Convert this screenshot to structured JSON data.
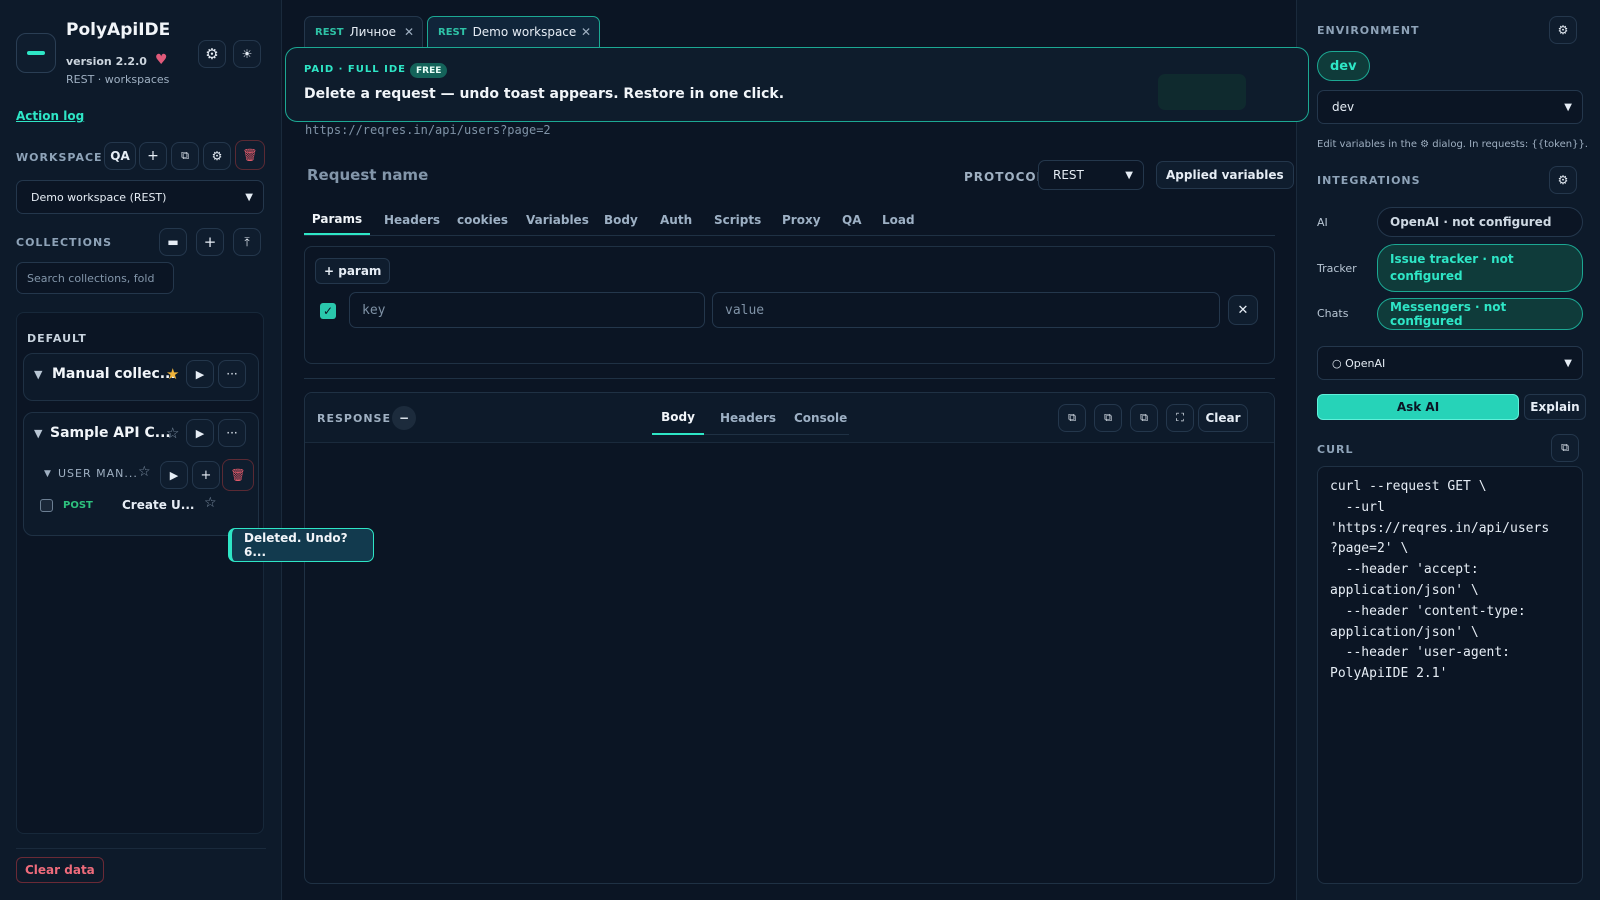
{
  "app": {
    "name": "PolyApiIDE",
    "version": "version 2.2.0",
    "subtitle": "REST · workspaces",
    "action_log": "Action log",
    "clear_data": "Clear data"
  },
  "workspace": {
    "label": "WORKSPACE",
    "badge": "QA",
    "selected": "Demo workspace (REST)"
  },
  "collections": {
    "label": "COLLECTIONS",
    "search_placeholder": "Search collections, fold",
    "group": "DEFAULT",
    "items": [
      {
        "name": "Manual collec...",
        "starred": true
      },
      {
        "name": "Sample API C...",
        "starred": false
      }
    ],
    "folder": {
      "name": "USER MAN..."
    },
    "request": {
      "method": "POST",
      "name": "Create U..."
    }
  },
  "undo_toast": "Deleted. Undo? 6...",
  "tabs": [
    {
      "proto": "REST",
      "label": "Личное"
    },
    {
      "proto": "REST",
      "label": "Demo workspace"
    }
  ],
  "banner": {
    "tier": "PAID · FULL IDE",
    "badge": "FREE",
    "message": "Delete a request — undo toast appears. Restore in one click."
  },
  "request": {
    "url": "https://reqres.in/api/users?page=2",
    "name_placeholder": "Request name",
    "protocol_label": "PROTOCOL",
    "protocol": "REST",
    "applied_vars": "Applied variables",
    "tabs": [
      "Params",
      "Headers",
      "cookies",
      "Variables",
      "Body",
      "Auth",
      "Scripts",
      "Proxy",
      "QA",
      "Load"
    ],
    "active_tab": "Params",
    "add_param": "+ param",
    "key_placeholder": "key",
    "value_placeholder": "value"
  },
  "response": {
    "label": "RESPONSE",
    "tabs": [
      "Body",
      "Headers",
      "Console"
    ],
    "active_tab": "Body",
    "clear": "Clear"
  },
  "environment": {
    "label": "ENVIRONMENT",
    "active": "dev",
    "selected": "dev",
    "hint": "Edit variables in the ⚙ dialog. In requests: {{token}}."
  },
  "integrations": {
    "label": "INTEGRATIONS",
    "items": [
      {
        "name": "AI",
        "value": "OpenAI · not configured"
      },
      {
        "name": "Tracker",
        "value": "Issue tracker · not configured"
      },
      {
        "name": "Chats",
        "value": "Messengers · not configured"
      }
    ],
    "ai_provider": "○ OpenAI",
    "ask": "Ask AI",
    "explain": "Explain"
  },
  "curl": {
    "label": "CURL",
    "text": "curl --request GET \\\n  --url\n'https://reqres.in/api/users\n?page=2' \\\n  --header 'accept:\napplication/json' \\\n  --header 'content-type:\napplication/json' \\\n  --header 'user-agent:\nPolyApiIDE 2.1'"
  },
  "colors": {
    "accent": "#2ee6c6",
    "danger": "#e05a6a",
    "bg": "#0b1524",
    "panel": "#0d1a2a"
  }
}
